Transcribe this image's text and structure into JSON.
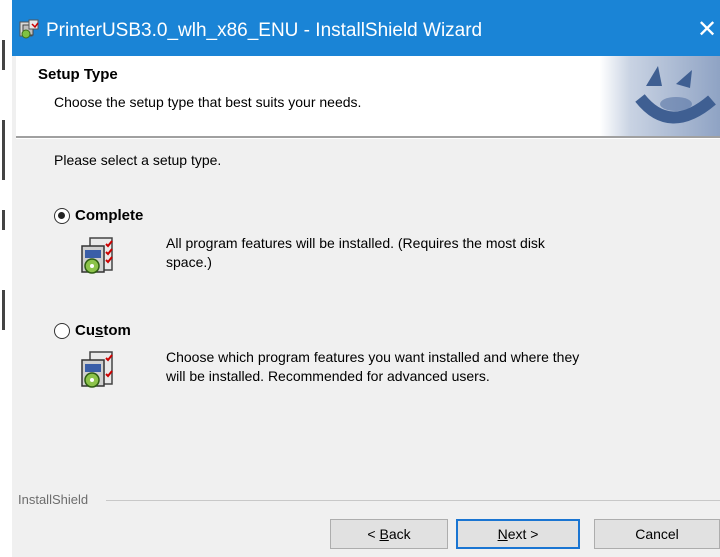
{
  "window": {
    "title": "PrinterUSB3.0_wlh_x86_ENU - InstallShield Wizard",
    "close_glyph": "✕",
    "title_icon": "installer-icon"
  },
  "banner": {
    "title": "Setup Type",
    "subtitle": "Choose the setup type that best suits your needs."
  },
  "prompt": "Please select a setup type.",
  "options": [
    {
      "label_first": "Complete",
      "label_rest": "",
      "selected": true,
      "description_line1": "All program features will be installed. (Requires the most disk",
      "description_line2": "space.)"
    },
    {
      "label_first": "Cu",
      "label_underlined": "s",
      "label_rest": "tom",
      "selected": false,
      "description_line1": "Choose which program features you want installed and where they",
      "description_line2": "will be installed. Recommended for advanced users."
    }
  ],
  "footer": {
    "brand": "InstallShield"
  },
  "buttons": {
    "back_prefix": "< ",
    "back_access": "B",
    "back_rest": "ack",
    "next_access": "N",
    "next_rest": "ext >",
    "cancel": "Cancel"
  },
  "colors": {
    "titlebar": "#1a84d6",
    "dialog_bg": "#f0f0f0",
    "default_button_border": "#1a75d2"
  }
}
